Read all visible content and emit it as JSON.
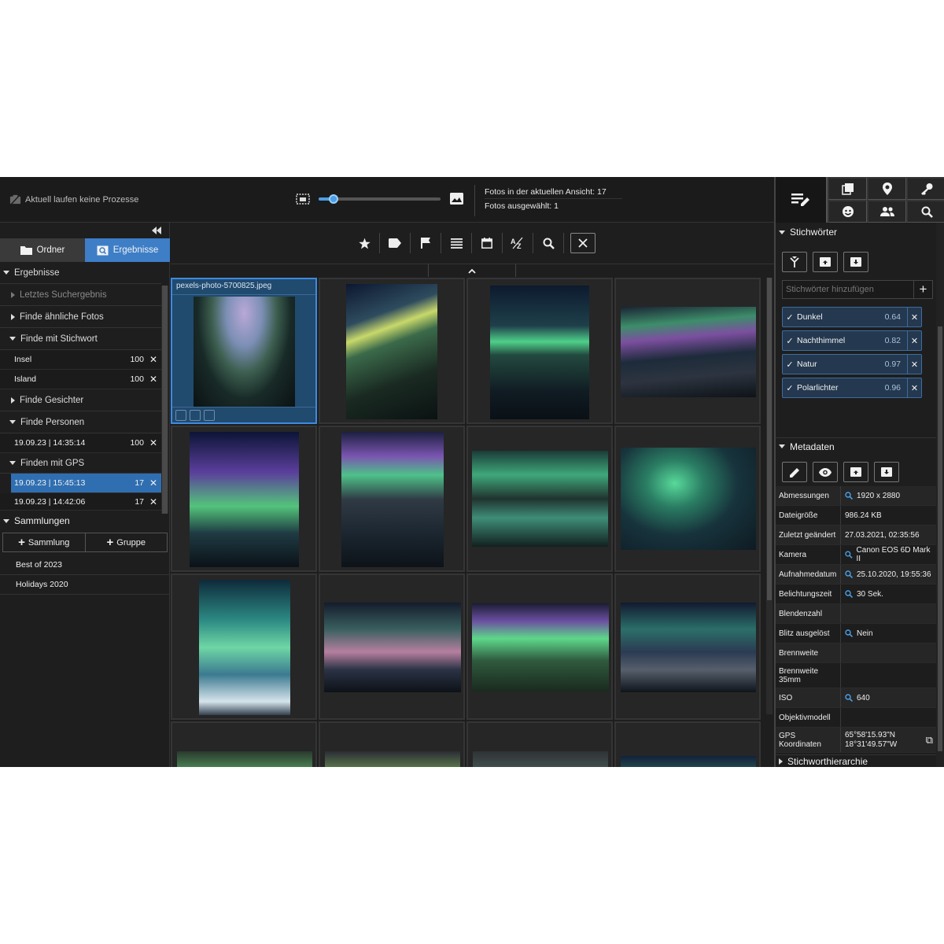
{
  "topbar": {
    "process_status": "Aktuell laufen keine Prozesse",
    "zoom_value": 0.12,
    "stats": {
      "photos_in_view": "Fotos in der aktuellen Ansicht: 17",
      "photos_selected": "Fotos ausgewählt: 1"
    }
  },
  "left": {
    "tabs": [
      {
        "label": "Ordner",
        "icon": "folder-icon",
        "active": false
      },
      {
        "label": "Ergebnisse",
        "icon": "search-results-icon",
        "active": true
      }
    ],
    "results_header": "Ergebnisse",
    "last_search": "Letztes Suchergebnis",
    "similar": "Finde ähnliche Fotos",
    "by_keyword": "Finde mit Stichwort",
    "keyword_items": [
      {
        "label": "Insel",
        "value": "100"
      },
      {
        "label": "Island",
        "value": "100"
      }
    ],
    "faces": "Finde Gesichter",
    "persons": "Finde Personen",
    "person_items": [
      {
        "label": "19.09.23 | 14:35:14",
        "value": "100"
      }
    ],
    "gps": "Finden mit GPS",
    "gps_items": [
      {
        "label": "19.09.23 | 15:45:13",
        "value": "17",
        "selected": true
      },
      {
        "label": "19.09.23 | 14:42:06",
        "value": "17",
        "selected": false
      }
    ],
    "collections_header": "Sammlungen",
    "add_collection": "Sammlung",
    "add_group": "Gruppe",
    "collections": [
      "Best of 2023",
      "Holidays 2020"
    ]
  },
  "grid": {
    "selected_filename": "pexels-photo-5700825.jpeg"
  },
  "right": {
    "keywords_header": "Stichwörter",
    "keyword_placeholder": "Stichwörter hinzufügen",
    "keywords": [
      {
        "label": "Dunkel",
        "score": "0.64"
      },
      {
        "label": "Nachthimmel",
        "score": "0.82"
      },
      {
        "label": "Natur",
        "score": "0.97"
      },
      {
        "label": "Polarlichter",
        "score": "0.96"
      }
    ],
    "metadata_header": "Metadaten",
    "metadata": [
      {
        "key": "Abmessungen",
        "value": "1920 x 2880",
        "search": true
      },
      {
        "key": "Dateigröße",
        "value": "986.24 KB",
        "search": false
      },
      {
        "key": "Zuletzt geändert",
        "value": "27.03.2021, 02:35:56",
        "search": false
      },
      {
        "key": "Kamera",
        "value": "Canon EOS 6D Mark II",
        "search": true
      },
      {
        "key": "Aufnahmedatum",
        "value": "25.10.2020, 19:55:36",
        "search": true
      },
      {
        "key": "Belichtungszeit",
        "value": "30 Sek.",
        "search": true
      },
      {
        "key": "Blendenzahl",
        "value": "",
        "search": false
      },
      {
        "key": "Blitz ausgelöst",
        "value": "Nein",
        "search": true
      },
      {
        "key": "Brennweite",
        "value": "",
        "search": false
      },
      {
        "key": "Brennweite 35mm",
        "value": "",
        "search": false
      },
      {
        "key": "ISO",
        "value": "640",
        "search": true
      },
      {
        "key": "Objektivmodell",
        "value": "",
        "search": false
      },
      {
        "key": "GPS Koordinaten",
        "value": "65°58'15.93\"N 18°31'49.57\"W",
        "search": false
      }
    ],
    "hierarchy_header": "Stichworthierarchie"
  },
  "colors": {
    "accent": "#3d7ec7",
    "aurora_green": "#5fd08a",
    "aurora_purple": "#a070d0"
  }
}
